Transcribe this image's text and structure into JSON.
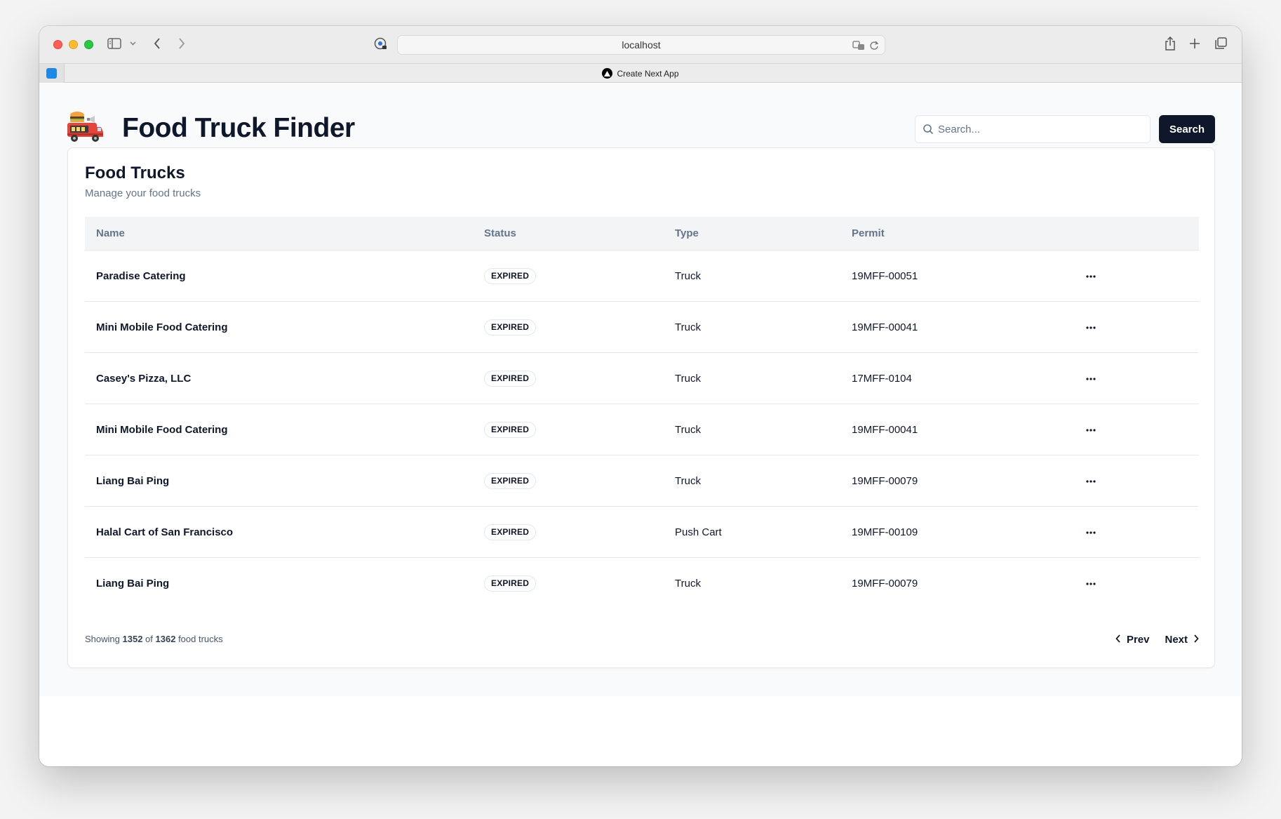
{
  "browser": {
    "url": "localhost",
    "tab_title": "Create Next App"
  },
  "header": {
    "logo_icon": "food-truck-emoji",
    "title": "Food Truck Finder",
    "search_placeholder": "Search...",
    "search_value": "",
    "search_button": "Search"
  },
  "card": {
    "title": "Food Trucks",
    "subtitle": "Manage your food trucks"
  },
  "table": {
    "columns": [
      "Name",
      "Status",
      "Type",
      "Permit"
    ],
    "rows": [
      {
        "name": "Paradise Catering",
        "status": "EXPIRED",
        "type": "Truck",
        "permit": "19MFF-00051"
      },
      {
        "name": "Mini Mobile Food Catering",
        "status": "EXPIRED",
        "type": "Truck",
        "permit": "19MFF-00041"
      },
      {
        "name": "Casey's Pizza, LLC",
        "status": "EXPIRED",
        "type": "Truck",
        "permit": "17MFF-0104"
      },
      {
        "name": "Mini Mobile Food Catering",
        "status": "EXPIRED",
        "type": "Truck",
        "permit": "19MFF-00041"
      },
      {
        "name": "Liang Bai Ping",
        "status": "EXPIRED",
        "type": "Truck",
        "permit": "19MFF-00079"
      },
      {
        "name": "Halal Cart of San Francisco",
        "status": "EXPIRED",
        "type": "Push Cart",
        "permit": "19MFF-00109"
      },
      {
        "name": "Liang Bai Ping",
        "status": "EXPIRED",
        "type": "Truck",
        "permit": "19MFF-00079"
      }
    ]
  },
  "footer": {
    "showing_prefix": "Showing",
    "shown_count": "1352",
    "of_label": "of",
    "total_count": "1362",
    "suffix": "food trucks",
    "prev_label": "Prev",
    "next_label": "Next"
  },
  "colors": {
    "primary": "#0f172a",
    "muted_text": "#64748b",
    "page_bg": "#f8fafc",
    "border": "#e5e7eb"
  }
}
